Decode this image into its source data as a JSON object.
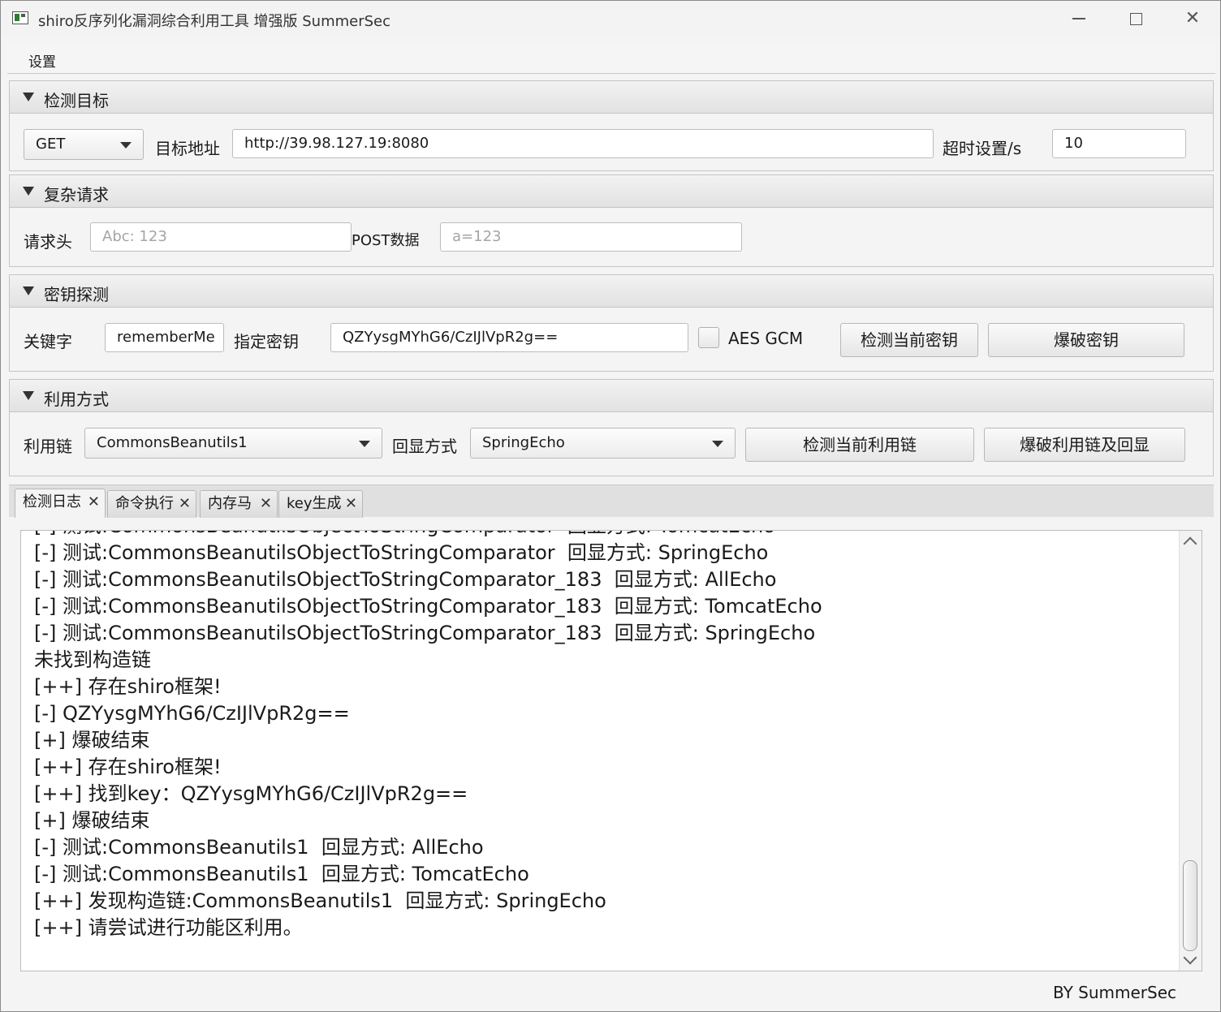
{
  "window": {
    "title": "shiro反序列化漏洞综合利用工具 增强版 SummerSec"
  },
  "menu": {
    "settings": "设置"
  },
  "target": {
    "title": "检测目标",
    "method": "GET",
    "url_label": "目标地址",
    "url": "http://39.98.127.19:8080",
    "timeout_label": "超时设置/s",
    "timeout": "10"
  },
  "complex": {
    "title": "复杂请求",
    "header_label": "请求头",
    "header_placeholder": "Abc: 123",
    "post_label": "POST数据",
    "post_placeholder": "a=123"
  },
  "key": {
    "title": "密钥探测",
    "keyword_label": "关键字",
    "keyword": "rememberMe",
    "key_label": "指定密钥",
    "key": "QZYysgMYhG6/CzIJlVpR2g==",
    "aes_gcm_label": "AES GCM",
    "aes_gcm_checked": false,
    "detect_btn": "检测当前密钥",
    "brute_btn": "爆破密钥"
  },
  "exploit": {
    "title": "利用方式",
    "chain_label": "利用链",
    "chain": "CommonsBeanutils1",
    "echo_label": "回显方式",
    "echo": "SpringEcho",
    "detect_btn": "检测当前利用链",
    "brute_btn": "爆破利用链及回显"
  },
  "tabs": [
    {
      "label": "检测日志",
      "close": "✕"
    },
    {
      "label": "命令执行",
      "close": "✕"
    },
    {
      "label": "内存马",
      "close": "✕"
    },
    {
      "label": "key生成",
      "close": "✕"
    }
  ],
  "log": [
    "[-] 测试:CommonsBeanutilsObjectToStringComparator  回显方式: TomcatEcho",
    "[-] 测试:CommonsBeanutilsObjectToStringComparator  回显方式: SpringEcho",
    "[-] 测试:CommonsBeanutilsObjectToStringComparator_183  回显方式: AllEcho",
    "[-] 测试:CommonsBeanutilsObjectToStringComparator_183  回显方式: TomcatEcho",
    "[-] 测试:CommonsBeanutilsObjectToStringComparator_183  回显方式: SpringEcho",
    "未找到构造链",
    "[++] 存在shiro框架!",
    "[-] QZYysgMYhG6/CzIJlVpR2g==",
    "[+] 爆破结束",
    "[++] 存在shiro框架!",
    "[++] 找到key：QZYysgMYhG6/CzIJlVpR2g==",
    "[+] 爆破结束",
    "[-] 测试:CommonsBeanutils1  回显方式: AllEcho",
    "[-] 测试:CommonsBeanutils1  回显方式: TomcatEcho",
    "[++] 发现构造链:CommonsBeanutils1  回显方式: SpringEcho",
    "[++] 请尝试进行功能区利用。"
  ],
  "footer": "BY   SummerSec"
}
